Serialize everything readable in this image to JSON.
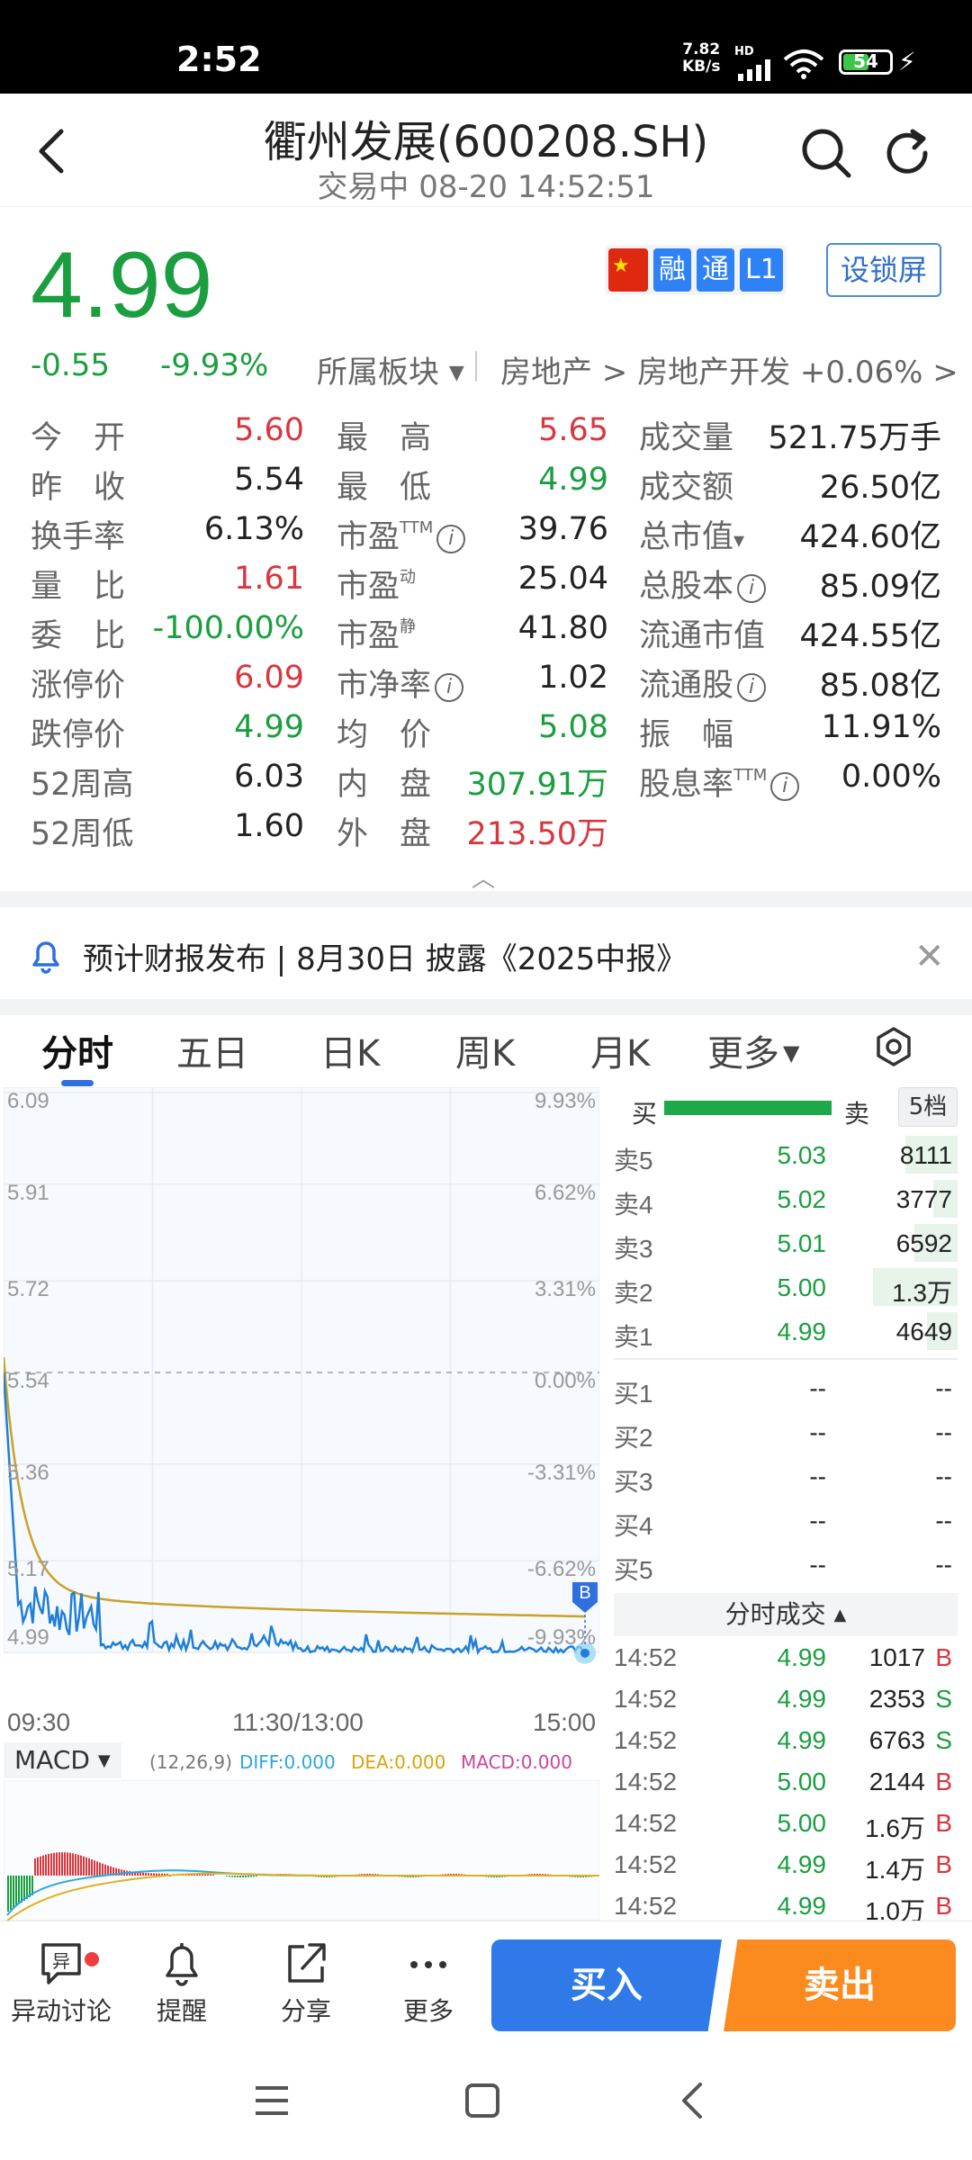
{
  "status_bar": {
    "time": "2:52",
    "net_speed": "7.82",
    "net_unit": "KB/s",
    "hd": "HD",
    "battery": "54",
    "battery_level": 0.54
  },
  "header": {
    "title": "衢州发展(600208.SH)",
    "subtitle": "交易中 08-20 14:52:51"
  },
  "quote": {
    "price": "4.99",
    "change": "-0.55",
    "change_pct": "-9.93%",
    "sector_label": "所属板块",
    "sector_path": "房地产 > 房地产开发 +0.06% >",
    "badges": {
      "rong": "融",
      "tong": "通",
      "l1": "L1"
    },
    "lock_screen": "设锁屏"
  },
  "stats": [
    [
      {
        "label": "今　开",
        "value": "5.60",
        "color": "red"
      },
      {
        "label": "最　高",
        "value": "5.65",
        "color": "red"
      },
      {
        "label": "成交量",
        "value": "521.75万手",
        "color": "black"
      }
    ],
    [
      {
        "label": "昨　收",
        "value": "5.54",
        "color": "black"
      },
      {
        "label": "最　低",
        "value": "4.99",
        "color": "green"
      },
      {
        "label": "成交额",
        "value": "26.50亿",
        "color": "black"
      }
    ],
    [
      {
        "label": "换手率",
        "value": "6.13%",
        "color": "black"
      },
      {
        "label": "市盈",
        "sup": "TTM",
        "info": true,
        "value": "39.76",
        "color": "black"
      },
      {
        "label": "总市值",
        "caret": true,
        "value": "424.60亿",
        "color": "black"
      }
    ],
    [
      {
        "label": "量　比",
        "value": "1.61",
        "color": "red"
      },
      {
        "label": "市盈",
        "sup": "动",
        "value": "25.04",
        "color": "black"
      },
      {
        "label": "总股本",
        "info": true,
        "value": "85.09亿",
        "color": "black"
      }
    ],
    [
      {
        "label": "委　比",
        "value": "-100.00%",
        "color": "green"
      },
      {
        "label": "市盈",
        "sup": "静",
        "value": "41.80",
        "color": "black"
      },
      {
        "label": "流通市值",
        "value": "424.55亿",
        "color": "black"
      }
    ],
    [
      {
        "label": "涨停价",
        "value": "6.09",
        "color": "red"
      },
      {
        "label": "市净率",
        "info": true,
        "value": "1.02",
        "color": "black"
      },
      {
        "label": "流通股",
        "info": true,
        "value": "85.08亿",
        "color": "black"
      }
    ],
    [
      {
        "label": "跌停价",
        "value": "4.99",
        "color": "green"
      },
      {
        "label": "均　价",
        "value": "5.08",
        "color": "green"
      },
      {
        "label": "振　幅",
        "value": "11.91%",
        "color": "black"
      }
    ],
    [
      {
        "label": "52周高",
        "value": "6.03",
        "color": "black"
      },
      {
        "label": "内　盘",
        "value": "307.91万",
        "color": "green"
      },
      {
        "label": "股息率",
        "sup": "TTM",
        "info": true,
        "value": "0.00%",
        "color": "black"
      }
    ],
    [
      {
        "label": "52周低",
        "value": "1.60",
        "color": "black"
      },
      {
        "label": "外　盘",
        "value": "213.50万",
        "color": "red"
      },
      null
    ]
  ],
  "notice": {
    "text": "预计财报发布 | 8月30日 披露《2025中报》"
  },
  "tabs": [
    "分时",
    "五日",
    "日K",
    "周K",
    "月K",
    "更多"
  ],
  "chart": {
    "price_ticks": [
      "6.09",
      "5.91",
      "5.72",
      "5.54",
      "5.36",
      "5.17",
      "4.99"
    ],
    "pct_ticks": [
      "9.93%",
      "6.62%",
      "3.31%",
      "0.00%",
      "-3.31%",
      "-6.62%",
      "-9.93%"
    ],
    "time_labels": [
      "09:30",
      "11:30/13:00",
      "15:00"
    ],
    "marker": "B",
    "macd": {
      "name": "MACD",
      "params": "(12,26,9)",
      "diff": "DIFF:0.000",
      "dea": "DEA:0.000",
      "macd": "MACD:0.000"
    },
    "colors": {
      "price": "#1f7ed8",
      "avg": "#c9a227",
      "diff": "#2aa7e0",
      "dea": "#e0b020",
      "macd": "#c8469c"
    }
  },
  "order_book": {
    "buy": "买",
    "sell": "卖",
    "levels": "5档",
    "asks": [
      {
        "label": "卖5",
        "price": "5.03",
        "vol": "8111",
        "share": 0.62
      },
      {
        "label": "卖4",
        "price": "5.02",
        "vol": "3777",
        "share": 0.29
      },
      {
        "label": "卖3",
        "price": "5.01",
        "vol": "6592",
        "share": 0.51
      },
      {
        "label": "卖2",
        "price": "5.00",
        "vol": "1.3万",
        "share": 1.0
      },
      {
        "label": "卖1",
        "price": "4.99",
        "vol": "4649",
        "share": 0.36
      }
    ],
    "bids": [
      {
        "label": "买1",
        "price": "--",
        "vol": "--"
      },
      {
        "label": "买2",
        "price": "--",
        "vol": "--"
      },
      {
        "label": "买3",
        "price": "--",
        "vol": "--"
      },
      {
        "label": "买4",
        "price": "--",
        "vol": "--"
      },
      {
        "label": "买5",
        "price": "--",
        "vol": "--"
      }
    ],
    "ticks_title": "分时成交",
    "ticks": [
      {
        "time": "14:52",
        "price": "4.99",
        "vol": "1017",
        "side": "B"
      },
      {
        "time": "14:52",
        "price": "4.99",
        "vol": "2353",
        "side": "S"
      },
      {
        "time": "14:52",
        "price": "4.99",
        "vol": "6763",
        "side": "S"
      },
      {
        "time": "14:52",
        "price": "5.00",
        "vol": "2144",
        "side": "B"
      },
      {
        "time": "14:52",
        "price": "5.00",
        "vol": "1.6万",
        "side": "B"
      },
      {
        "time": "14:52",
        "price": "4.99",
        "vol": "1.4万",
        "side": "B"
      },
      {
        "time": "14:52",
        "price": "4.99",
        "vol": "1.0万",
        "side": "B"
      }
    ]
  },
  "toolbar": {
    "discuss": "异动讨论",
    "alert": "提醒",
    "share": "分享",
    "more": "更多",
    "buy": "买入",
    "sell": "卖出"
  }
}
